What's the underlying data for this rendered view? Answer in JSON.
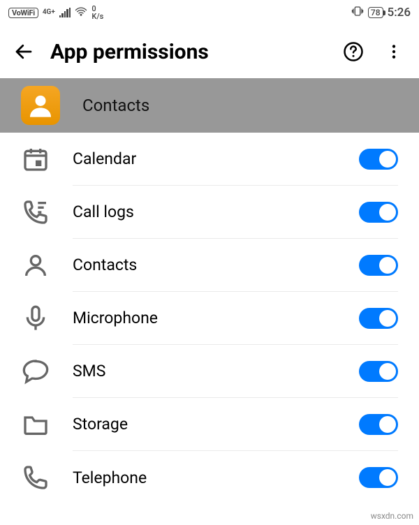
{
  "statusbar": {
    "vowifi": "VoWiFi",
    "network": "4G+",
    "speed_num": "0",
    "speed_unit": "K/s",
    "battery": "78",
    "time": "5:26"
  },
  "header": {
    "title": "App permissions"
  },
  "app": {
    "name": "Contacts"
  },
  "permissions": [
    {
      "label": "Calendar",
      "enabled": true,
      "icon": "calendar-icon"
    },
    {
      "label": "Call logs",
      "enabled": true,
      "icon": "call-logs-icon"
    },
    {
      "label": "Contacts",
      "enabled": true,
      "icon": "contacts-icon"
    },
    {
      "label": "Microphone",
      "enabled": true,
      "icon": "microphone-icon"
    },
    {
      "label": "SMS",
      "enabled": true,
      "icon": "sms-icon"
    },
    {
      "label": "Storage",
      "enabled": true,
      "icon": "storage-icon"
    },
    {
      "label": "Telephone",
      "enabled": true,
      "icon": "telephone-icon"
    }
  ],
  "watermark": "wsxdn.com"
}
